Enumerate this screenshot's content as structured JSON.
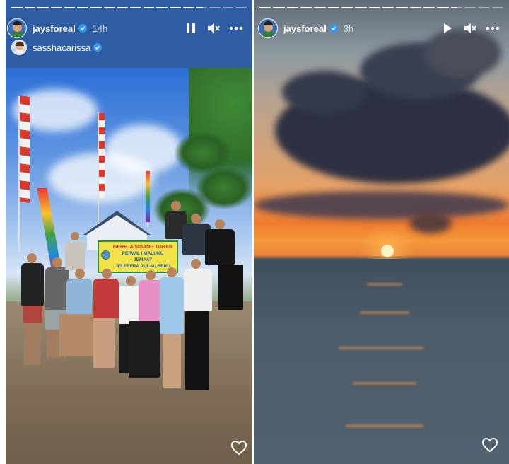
{
  "stories": [
    {
      "username": "jaysforeal",
      "time": "14h",
      "collaborator": "sasshacarissa",
      "progress_segments": [
        1,
        1,
        1,
        1,
        1,
        1,
        1,
        1,
        1,
        1,
        1,
        1,
        1,
        1,
        0.6,
        0,
        0,
        0
      ],
      "controls": [
        "pause-icon",
        "mute-icon",
        "more-icon"
      ],
      "sign": {
        "line1": "GEREJA SIDANG TUHAN",
        "line2": "PERWIL I MALUKU",
        "line3": "JEMAAT",
        "line4": "JELEEFRA PULAU SERU"
      },
      "like_icon": "heart-icon"
    },
    {
      "username": "jaysforeal",
      "time": "3h",
      "progress_segments": [
        1,
        1,
        1,
        1,
        1,
        1,
        1,
        1,
        1,
        1,
        1,
        1,
        1,
        1,
        0.5,
        0,
        0,
        0
      ],
      "controls": [
        "play-icon",
        "mute-icon",
        "more-icon"
      ],
      "like_icon": "heart-icon"
    }
  ],
  "colors": {
    "verified": "#3797f0",
    "header_bar": "#2f5da3"
  }
}
